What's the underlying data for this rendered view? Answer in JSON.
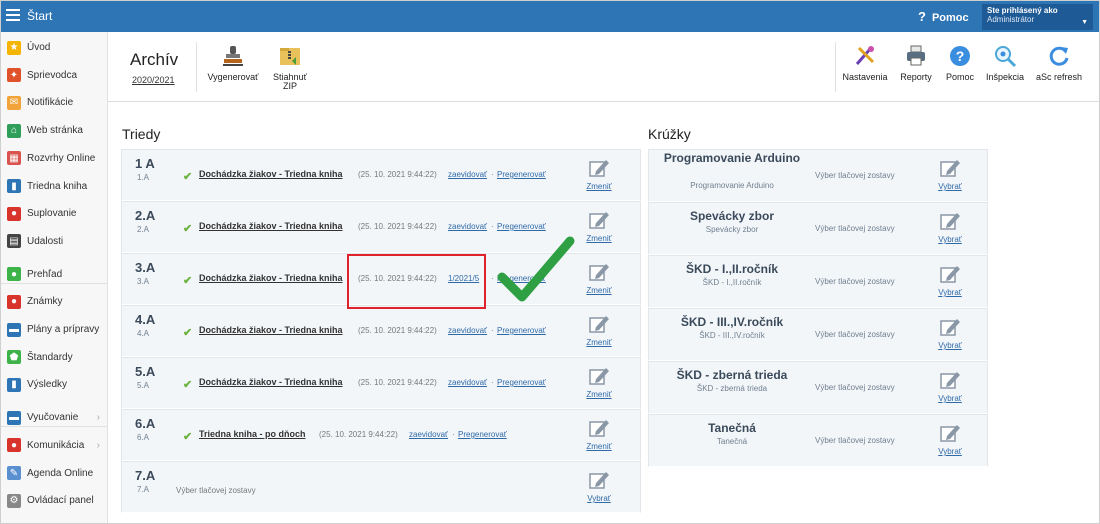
{
  "topbar": {
    "title": "Štart",
    "help_label": "Pomoc",
    "help_symbol": "?",
    "user_line1": "Ste prihlásený ako",
    "user_line2": "Administrátor"
  },
  "sidebar": [
    {
      "label": "Úvod",
      "icon": "star-icon",
      "color": "#f5b400"
    },
    {
      "label": "Sprievodca",
      "icon": "wizard-icon",
      "color": "#e0522a"
    },
    {
      "label": "Notifikácie",
      "icon": "envelope-icon",
      "color": "#f2a33a"
    },
    {
      "label": "Web stránka",
      "icon": "house-icon",
      "color": "#2f9e5a"
    },
    {
      "label": "Rozvrhy Online",
      "icon": "calendar-icon",
      "color": "#d9534f"
    },
    {
      "label": "Triedna kniha",
      "icon": "book-icon",
      "color": "#2e75b6"
    },
    {
      "label": "Suplovanie",
      "icon": "person-icon",
      "color": "#d9342b"
    },
    {
      "label": "Udalosti",
      "icon": "events-icon",
      "color": "#444"
    },
    {
      "label": "Prehľad",
      "icon": "overview-icon",
      "color": "#3db34a"
    },
    {
      "label": "Známky",
      "icon": "grades-icon",
      "color": "#d9342b"
    },
    {
      "label": "Plány a prípravy",
      "icon": "plans-icon",
      "color": "#2e75b6"
    },
    {
      "label": "Štandardy",
      "icon": "shield-icon",
      "color": "#3db34a"
    },
    {
      "label": "Výsledky",
      "icon": "bar-chart-icon",
      "color": "#2e75b6"
    },
    {
      "label": "Vyučovanie",
      "icon": "teaching-icon",
      "color": "#2e75b6",
      "chevron": "›"
    },
    {
      "label": "Komunikácia",
      "icon": "chat-icon",
      "color": "#d9342b",
      "chevron": "›"
    },
    {
      "label": "Agenda Online",
      "icon": "pen-icon",
      "color": "#5a8fd0"
    },
    {
      "label": "Ovládací panel",
      "icon": "gear-icon",
      "color": "#888"
    }
  ],
  "toolbar": {
    "archive_title": "Archív",
    "archive_year": "2020/2021",
    "generate_label": "Vygenerovať",
    "download_zip_label1": "Stiahnuť",
    "download_zip_label2": "ZIP",
    "settings_label": "Nastavenia",
    "reports_label": "Reporty",
    "help_label": "Pomoc",
    "inspection_label": "Inšpekcia",
    "refresh_label": "aSc refresh"
  },
  "classes_title": "Triedy",
  "clubs_title": "Krúžky",
  "classes": [
    {
      "name": "1 A",
      "sub": "1.A",
      "link": "Dochádzka žiakov - Triedna kniha",
      "stamp": "(25. 10. 2021 9:44:22)",
      "action": "zaevidovať",
      "regen": "Pregenerovať",
      "edit": "Zmeniť"
    },
    {
      "name": "2.A",
      "sub": "2.A",
      "link": "Dochádzka žiakov - Triedna kniha",
      "stamp": "(25. 10. 2021 9:44:22)",
      "action": "zaevidovať",
      "regen": "Pregenerovať",
      "edit": "Zmeniť"
    },
    {
      "name": "3.A",
      "sub": "3.A",
      "link": "Dochádzka žiakov - Triedna kniha",
      "stamp": "(25. 10. 2021 9:44:22)",
      "action": "1/2021/5",
      "regen": "Pregenerovať",
      "edit": "Zmeniť"
    },
    {
      "name": "4.A",
      "sub": "4.A",
      "link": "Dochádzka žiakov - Triedna kniha",
      "stamp": "(25. 10. 2021 9:44:22)",
      "action": "zaevidovať",
      "regen": "Pregenerovať",
      "edit": "Zmeniť"
    },
    {
      "name": "5.A",
      "sub": "5.A",
      "link": "Dochádzka žiakov - Triedna kniha",
      "stamp": "(25. 10. 2021 9:44:22)",
      "action": "zaevidovať",
      "regen": "Pregenerovať",
      "edit": "Zmeniť"
    },
    {
      "name": "6.A",
      "sub": "6.A",
      "link": "Triedna kniha - po dňoch",
      "stamp": "(25. 10. 2021 9:44:22)",
      "action": "zaevidovať",
      "regen": "Pregenerovať",
      "edit": "Zmeniť"
    },
    {
      "name": "7.A",
      "sub": "7.A",
      "note": "Výber tlačovej zostavy",
      "edit": "Vybrať"
    }
  ],
  "clubs": [
    {
      "name": "Programovanie Arduino",
      "sub": "Programovanie Arduino",
      "note": "Výber tlačovej zostavy",
      "edit": "Vybrať"
    },
    {
      "name": "Spevácky zbor",
      "sub": "Spevácky zbor",
      "note": "Výber tlačovej zostavy",
      "edit": "Vybrať"
    },
    {
      "name": "ŠKD - I.,II.ročník",
      "sub": "ŠKD - I.,II.ročník",
      "note": "Výber tlačovej zostavy",
      "edit": "Vybrať"
    },
    {
      "name": "ŠKD - III.,IV.ročník",
      "sub": "ŠKD - III.,IV.ročník",
      "note": "Výber tlačovej zostavy",
      "edit": "Vybrať"
    },
    {
      "name": "ŠKD - zberná trieda",
      "sub": "ŠKD - zberná trieda",
      "note": "Výber tlačovej zostavy",
      "edit": "Vybrať"
    },
    {
      "name": "Tanečná",
      "sub": "Tanečná",
      "note": "Výber tlačovej zostavy",
      "edit": "Vybrať"
    }
  ],
  "colors": {
    "topbar": "#2e75b6",
    "check": "#6cb33f",
    "highlight": "#e0232a",
    "big_check": "#2ea043"
  }
}
